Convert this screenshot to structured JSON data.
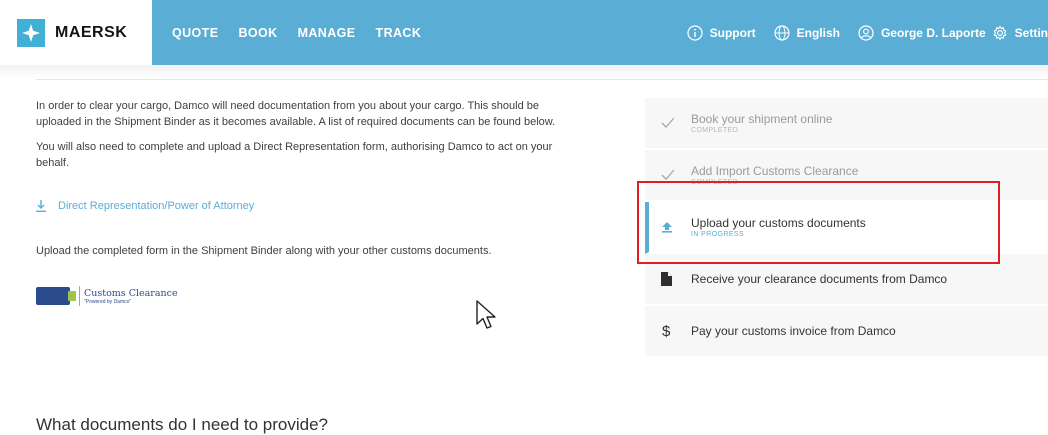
{
  "header": {
    "brand": "MAERSK",
    "nav": [
      "QUOTE",
      "BOOK",
      "MANAGE",
      "TRACK"
    ],
    "support": "Support",
    "language": "English",
    "user": "George D. Laporte",
    "settings": "Settin"
  },
  "intro": {
    "paragraph1": "In order to clear your cargo, Damco will need documentation from you about your cargo. This should be uploaded in the Shipment Binder as it becomes available. A list of required documents can be found below.",
    "paragraph2": "You will also need to complete and upload a Direct Representation form, authorising Damco to act on your behalf.",
    "download_link": "Direct Representation/Power of Attorney",
    "upload_note": "Upload the completed form in the Shipment Binder along with your other customs documents.",
    "logo_title": "Customs Clearance",
    "logo_subtitle": "\"Powered by Damco\""
  },
  "steps": [
    {
      "title": "Book your shipment online",
      "status": "COMPLETED",
      "icon": "check-icon"
    },
    {
      "title": "Add Import Customs Clearance",
      "status": "COMPLETED",
      "icon": "check-icon"
    },
    {
      "title": "Upload your customs documents",
      "status": "IN PROGRESS",
      "icon": "upload-icon"
    },
    {
      "title": "Receive your clearance documents from Damco",
      "status": "",
      "icon": "document-icon"
    },
    {
      "title": "Pay your customs invoice from Damco",
      "status": "",
      "icon": "dollar-icon"
    }
  ],
  "section_heading": "What documents do I need to provide?",
  "colors": {
    "accent": "#5aaed6",
    "highlight": "#e02020"
  }
}
